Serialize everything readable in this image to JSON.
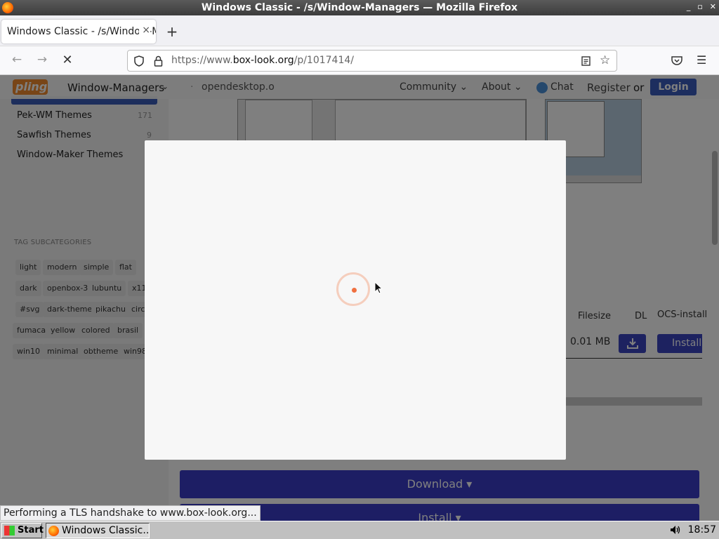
{
  "window": {
    "title": "Windows Classic - /s/Window-Managers — Mozilla Firefox",
    "min": "_",
    "max": "▫",
    "close": "✕"
  },
  "tab": {
    "title": "Windows Classic - /s/Window-Managers",
    "close": "×",
    "new_tab": "+"
  },
  "url": {
    "prefix": "https://www.",
    "host": "box-look.org",
    "path": "/p/1017414/"
  },
  "header": {
    "logo": "pling",
    "section": "Window-Managers",
    "section_caret": "⌄",
    "opendesktop": "opendesktop.o",
    "community": "Community ⌄",
    "about": "About ⌄",
    "chat": "Chat",
    "register": "Register",
    "or": "or",
    "login": "Login"
  },
  "sidebar": {
    "items": [
      {
        "label": "Pek-WM Themes",
        "count": "171"
      },
      {
        "label": "Sawfish Themes",
        "count": "9"
      },
      {
        "label": "Window-Maker Themes",
        "count": ""
      }
    ],
    "tag_title": "TAG SUBCATEGORIES",
    "tags": [
      [
        "light",
        "modern",
        "simple",
        "flat"
      ],
      [
        "dark",
        "openbox-3",
        "lubuntu",
        "x11"
      ],
      [
        "#svg",
        "dark-theme",
        "pikachu",
        "circle"
      ],
      [
        "fumaca",
        "yellow",
        "colored",
        "brasil"
      ],
      [
        "win10",
        "minimal",
        "obtheme",
        "win98"
      ]
    ]
  },
  "files_table": {
    "headers": {
      "filesize": "Filesize",
      "dl": "DL",
      "ocs": "OCS-install"
    },
    "row": {
      "filesize": "0.01 MB",
      "install": "Install"
    }
  },
  "buttons": {
    "download": "Download ▾",
    "install": "Install ▾"
  },
  "status": {
    "text": "Performing a TLS handshake to www.box-look.org..."
  },
  "taskbar": {
    "start": "Start",
    "app": "Windows Classic...",
    "clock": "18:57"
  },
  "colors": {
    "accent": "#3a3cc8",
    "login": "#3a5dbf",
    "logo": "#f08a2e"
  }
}
